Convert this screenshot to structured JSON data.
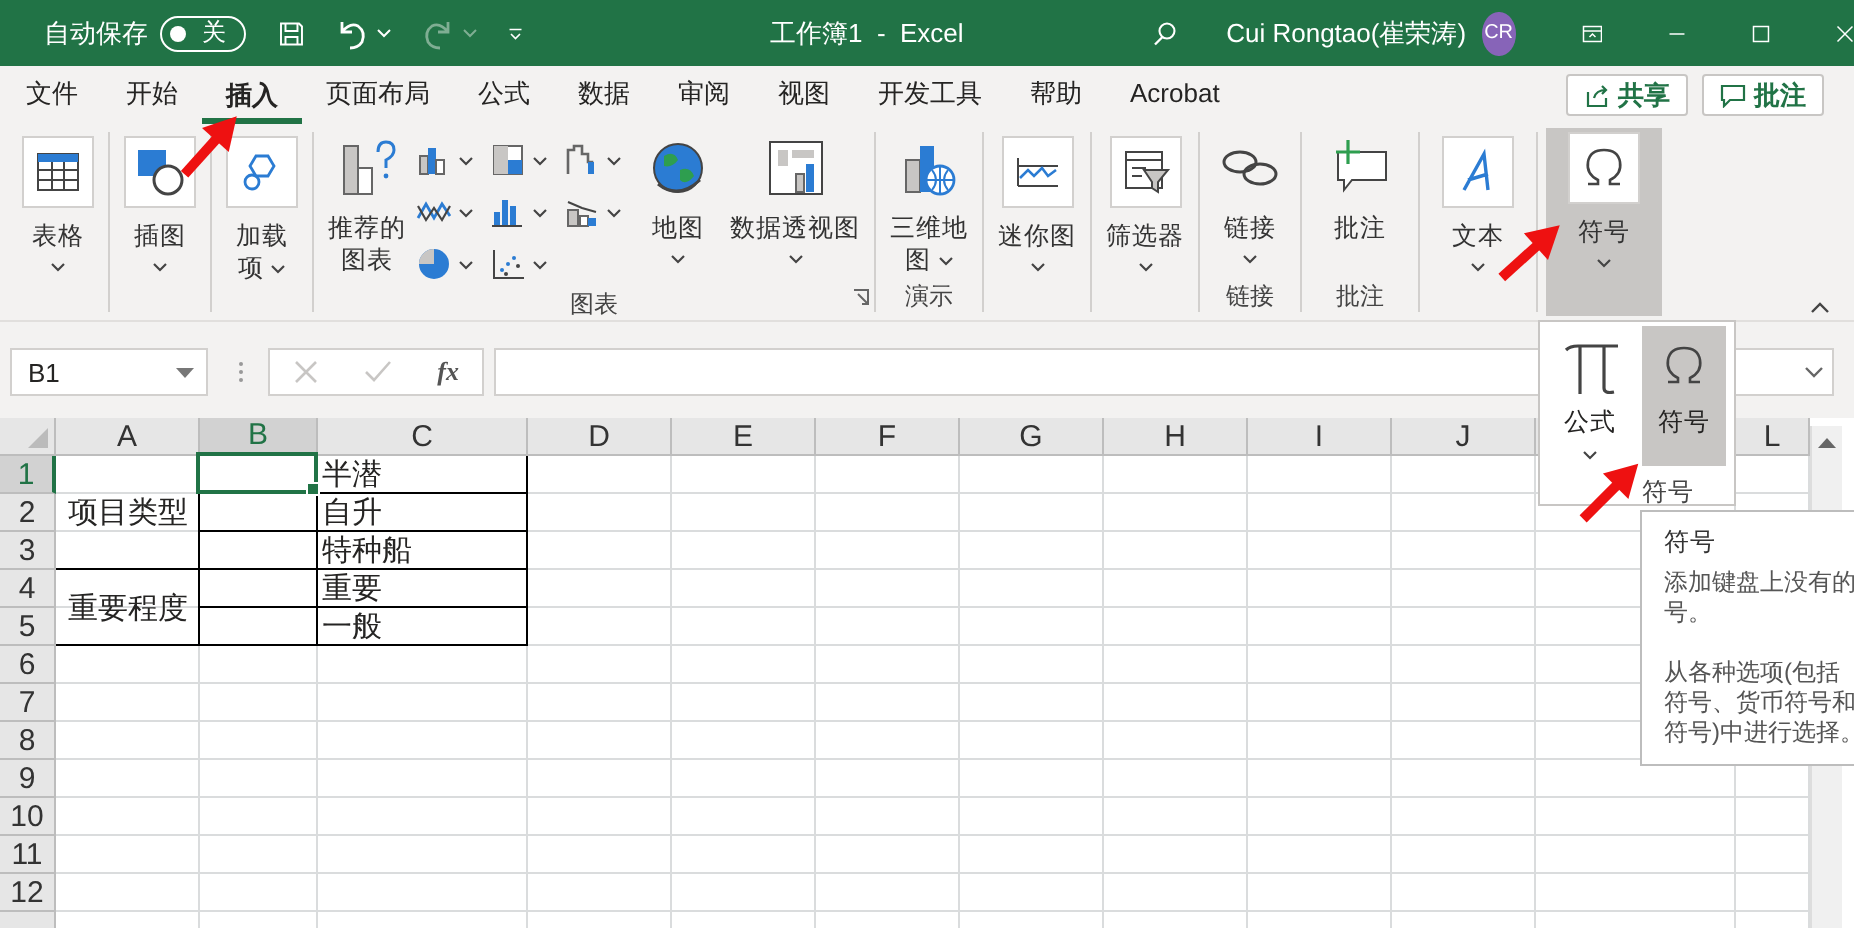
{
  "title_bar": {
    "autosave_label": "自动保存",
    "autosave": {
      "label": "关",
      "on": false
    },
    "redo_disabled": true,
    "title": "工作簿1  -  Excel",
    "user": "Cui Rongtao(崔荣涛)",
    "avatar": "CR"
  },
  "menu_tabs": [
    {
      "label": "文件",
      "selected": false
    },
    {
      "label": "开始",
      "selected": false
    },
    {
      "label": "插入",
      "selected": true
    },
    {
      "label": "页面布局",
      "selected": false
    },
    {
      "label": "公式",
      "selected": false
    },
    {
      "label": "数据",
      "selected": false
    },
    {
      "label": "审阅",
      "selected": false
    },
    {
      "label": "视图",
      "selected": false
    },
    {
      "label": "开发工具",
      "selected": false
    },
    {
      "label": "帮助",
      "selected": false
    },
    {
      "label": "Acrobat",
      "selected": false
    }
  ],
  "share_button": "共享",
  "comments_button": "批注",
  "ribbon": {
    "groups": [
      {
        "items": [
          {
            "kind": "table",
            "lines": [
              "表格"
            ],
            "caret": true,
            "hovered": false
          }
        ]
      },
      {
        "items": [
          {
            "kind": "shapes",
            "lines": [
              "插图"
            ],
            "caret": true,
            "hovered": false
          }
        ]
      },
      {
        "items": [
          {
            "kind": "addin",
            "lines": [
              "加载",
              "项"
            ],
            "caret": true,
            "hovered": false
          }
        ]
      },
      {
        "label": "图表",
        "launcher": true,
        "items": [
          {
            "kind": "recommend",
            "lines": [
              "推荐的",
              "图表"
            ],
            "caret": false,
            "hovered": false
          },
          {
            "kind": "gallery",
            "icons": [
              {
                "kind": "column"
              },
              {
                "kind": "treemap"
              },
              {
                "kind": "waterfall"
              },
              {
                "kind": "line"
              },
              {
                "kind": "histogram"
              },
              {
                "kind": "combo"
              },
              {
                "kind": "pie"
              },
              {
                "kind": "scatter"
              }
            ]
          },
          {
            "kind": "map",
            "lines": [
              "地图"
            ],
            "caret": true,
            "hovered": false
          },
          {
            "kind": "pivot",
            "lines": [
              "数据透视图"
            ],
            "caret": true,
            "hovered": false
          }
        ]
      },
      {
        "label": "演示",
        "items": [
          {
            "kind": "map3d",
            "lines": [
              "三维地",
              "图"
            ],
            "caret": true,
            "hovered": false
          }
        ]
      },
      {
        "items": [
          {
            "kind": "sparkline",
            "lines": [
              "迷你图"
            ],
            "caret": true,
            "hovered": false
          }
        ]
      },
      {
        "items": [
          {
            "kind": "slicer",
            "lines": [
              "筛选器"
            ],
            "caret": true,
            "hovered": false
          }
        ]
      },
      {
        "label": "链接",
        "items": [
          {
            "kind": "link",
            "lines": [
              "链接"
            ],
            "caret": true,
            "hovered": false
          }
        ]
      },
      {
        "label": "批注",
        "items": [
          {
            "kind": "comment",
            "lines": [
              "批注"
            ],
            "caret": false,
            "hovered": false
          }
        ]
      },
      {
        "items": [
          {
            "kind": "text",
            "lines": [
              "文本"
            ],
            "caret": true,
            "hovered": false
          }
        ]
      },
      {
        "items": [
          {
            "kind": "symbol",
            "lines": [
              "符号"
            ],
            "caret": true,
            "hovered": true
          }
        ]
      }
    ]
  },
  "formula_bar": {
    "name_box": "B1",
    "function_button": "fx",
    "edit_buttons_disabled": true
  },
  "columns": [
    {
      "label": "A",
      "selected": false
    },
    {
      "label": "B",
      "selected": true
    },
    {
      "label": "C",
      "selected": false
    },
    {
      "label": "D",
      "selected": false
    },
    {
      "label": "E",
      "selected": false
    },
    {
      "label": "F",
      "selected": false
    },
    {
      "label": "G",
      "selected": false
    },
    {
      "label": "H",
      "selected": false
    },
    {
      "label": "I",
      "selected": false
    },
    {
      "label": "J",
      "selected": false
    },
    {
      "label": "L",
      "selected": false
    }
  ],
  "row_headers": [
    {
      "label": "1",
      "selected": true
    },
    {
      "label": "2",
      "selected": false
    },
    {
      "label": "3",
      "selected": false
    },
    {
      "label": "4",
      "selected": false
    },
    {
      "label": "5",
      "selected": false
    },
    {
      "label": "6",
      "selected": false
    },
    {
      "label": "7",
      "selected": false
    },
    {
      "label": "8",
      "selected": false
    },
    {
      "label": "9",
      "selected": false
    },
    {
      "label": "10",
      "selected": false
    },
    {
      "label": "11",
      "selected": false
    },
    {
      "label": "12",
      "selected": false
    }
  ],
  "table": {
    "rows": [
      [
        {
          "text": "项目类型",
          "rowspan": 3
        },
        {
          "selected": true
        },
        {
          "text": "半潜"
        }
      ],
      [
        {
          "selected": false
        },
        {
          "text": "自升"
        }
      ],
      [
        {
          "selected": false
        },
        {
          "text": "特种船"
        }
      ],
      [
        {
          "text": "重要程度",
          "rowspan": 2
        },
        {
          "selected": false
        },
        {
          "text": "重要"
        }
      ],
      [
        {
          "selected": false
        },
        {
          "text": "一般"
        }
      ]
    ]
  },
  "symbols_popup": {
    "buttons": [
      {
        "kind": "equation",
        "label": "公式",
        "hovered": false,
        "caret": true
      },
      {
        "kind": "symbol",
        "label": "符号",
        "hovered": true,
        "caret": false
      }
    ],
    "group_label": "符号"
  },
  "tooltip": {
    "title": "符号",
    "paragraphs": [
      [
        "添加键盘上没有的",
        "号。"
      ],
      [
        "从各种选项(包括",
        "符号、货币符号和",
        "符号)中进行选择。"
      ]
    ]
  }
}
